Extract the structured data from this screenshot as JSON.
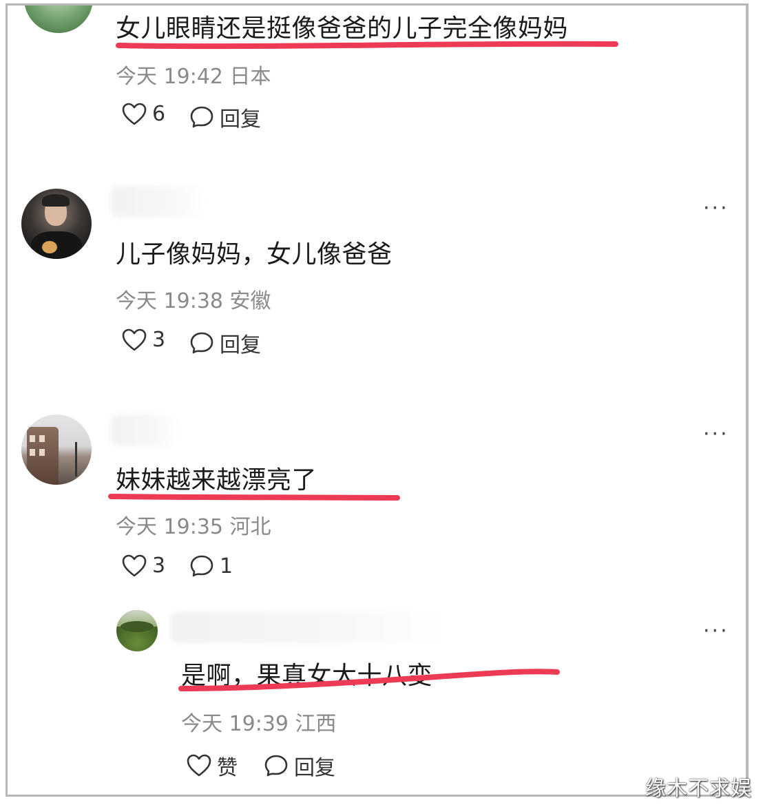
{
  "comments": [
    {
      "text": "女儿眼睛还是挺像爸爸的儿子完全像妈妈",
      "meta": "今天 19:42 日本",
      "likes": "6",
      "reply_label": "回复"
    },
    {
      "text": "儿子像妈妈，女儿像爸爸",
      "meta": "今天 19:38 安徽",
      "likes": "3",
      "reply_label": "回复"
    },
    {
      "text": "妹妹越来越漂亮了",
      "meta": "今天 19:35 河北",
      "likes": "3",
      "reply_count": "1"
    }
  ],
  "reply": {
    "text": "是啊，果真女大十八变",
    "meta": "今天 19:39 江西",
    "like_label": "赞",
    "reply_label": "回复"
  },
  "more_label": "···",
  "watermark": "缘木不求娱",
  "colors": {
    "underline": "#ee3b55",
    "meta_text": "#8a8a8a",
    "frame": "#b8b8b8"
  },
  "icons": [
    "heart-icon",
    "comment-bubble-icon",
    "more-icon"
  ]
}
